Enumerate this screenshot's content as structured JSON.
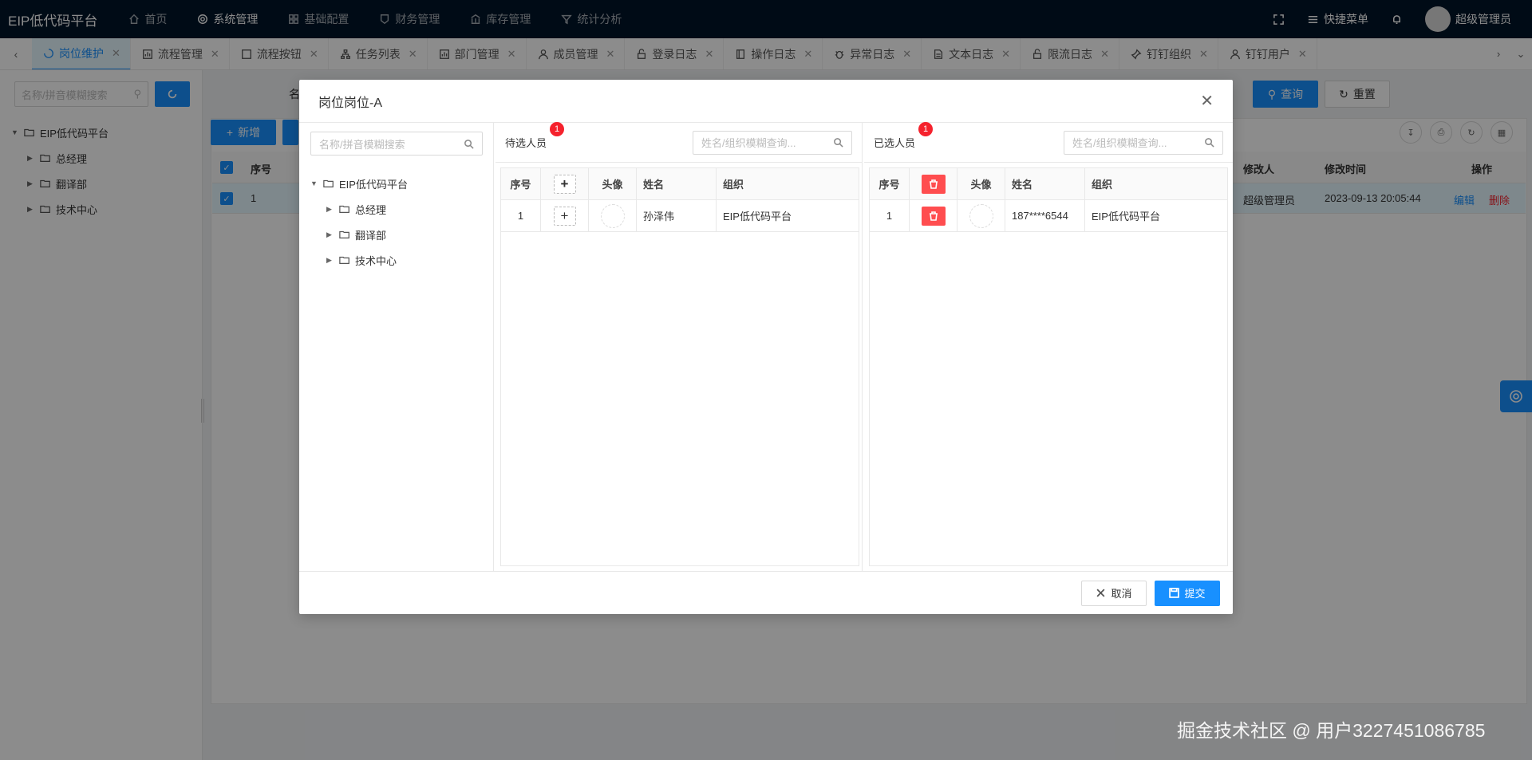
{
  "topbar": {
    "brand": "EIP低代码平台",
    "nav": [
      {
        "label": "首页",
        "icon": "home-icon"
      },
      {
        "label": "系统管理",
        "icon": "gear-icon"
      },
      {
        "label": "基础配置",
        "icon": "grid-icon"
      },
      {
        "label": "财务管理",
        "icon": "shield-icon"
      },
      {
        "label": "库存管理",
        "icon": "bank-icon"
      },
      {
        "label": "统计分析",
        "icon": "filter-icon"
      }
    ],
    "quick_menu": "快捷菜单",
    "user": "超级管理员"
  },
  "tabs": [
    {
      "label": "岗位维护",
      "active": true
    },
    {
      "label": "流程管理"
    },
    {
      "label": "流程按钮"
    },
    {
      "label": "任务列表"
    },
    {
      "label": "部门管理"
    },
    {
      "label": "成员管理"
    },
    {
      "label": "登录日志"
    },
    {
      "label": "操作日志"
    },
    {
      "label": "异常日志"
    },
    {
      "label": "文本日志"
    },
    {
      "label": "限流日志"
    },
    {
      "label": "钉钉组织"
    },
    {
      "label": "钉钉用户"
    }
  ],
  "background": {
    "search_placeholder": "名称/拼音模糊搜索",
    "tree": [
      "EIP低代码平台",
      "总经理",
      "翻译部",
      "技术中心"
    ],
    "form_label": "名",
    "query_label": "查询",
    "reset_label": "重置",
    "add_label": "新增",
    "table_headers": {
      "no": "序号",
      "modifier": "修改人",
      "modified_time": "修改时间",
      "action": "操作"
    },
    "row": {
      "no": "1",
      "modifier": "超级管理员",
      "modified_time": "2023-09-13 20:05:44",
      "edit": "编辑",
      "delete": "删除"
    }
  },
  "modal": {
    "title": "岗位岗位-A",
    "tree_search_placeholder": "名称/拼音模糊搜索",
    "tree": [
      "EIP低代码平台",
      "总经理",
      "翻译部",
      "技术中心"
    ],
    "pending": {
      "title": "待选人员",
      "badge": "1",
      "search_placeholder": "姓名/组织模糊查询...",
      "headers": {
        "no": "序号",
        "avatar": "头像",
        "name": "姓名",
        "org": "组织"
      },
      "rows": [
        {
          "no": "1",
          "name": "孙泽伟",
          "org": "EIP低代码平台"
        }
      ]
    },
    "selected": {
      "title": "已选人员",
      "badge": "1",
      "search_placeholder": "姓名/组织模糊查询...",
      "headers": {
        "no": "序号",
        "avatar": "头像",
        "name": "姓名",
        "org": "组织"
      },
      "rows": [
        {
          "no": "1",
          "name": "187****6544",
          "org": "EIP低代码平台"
        }
      ]
    },
    "cancel_label": "取消",
    "submit_label": "提交"
  },
  "watermark": "掘金技术社区 @ 用户3227451086785",
  "colors": {
    "primary": "#1890ff",
    "header_bg": "#001529",
    "danger": "#ff4d4f"
  }
}
